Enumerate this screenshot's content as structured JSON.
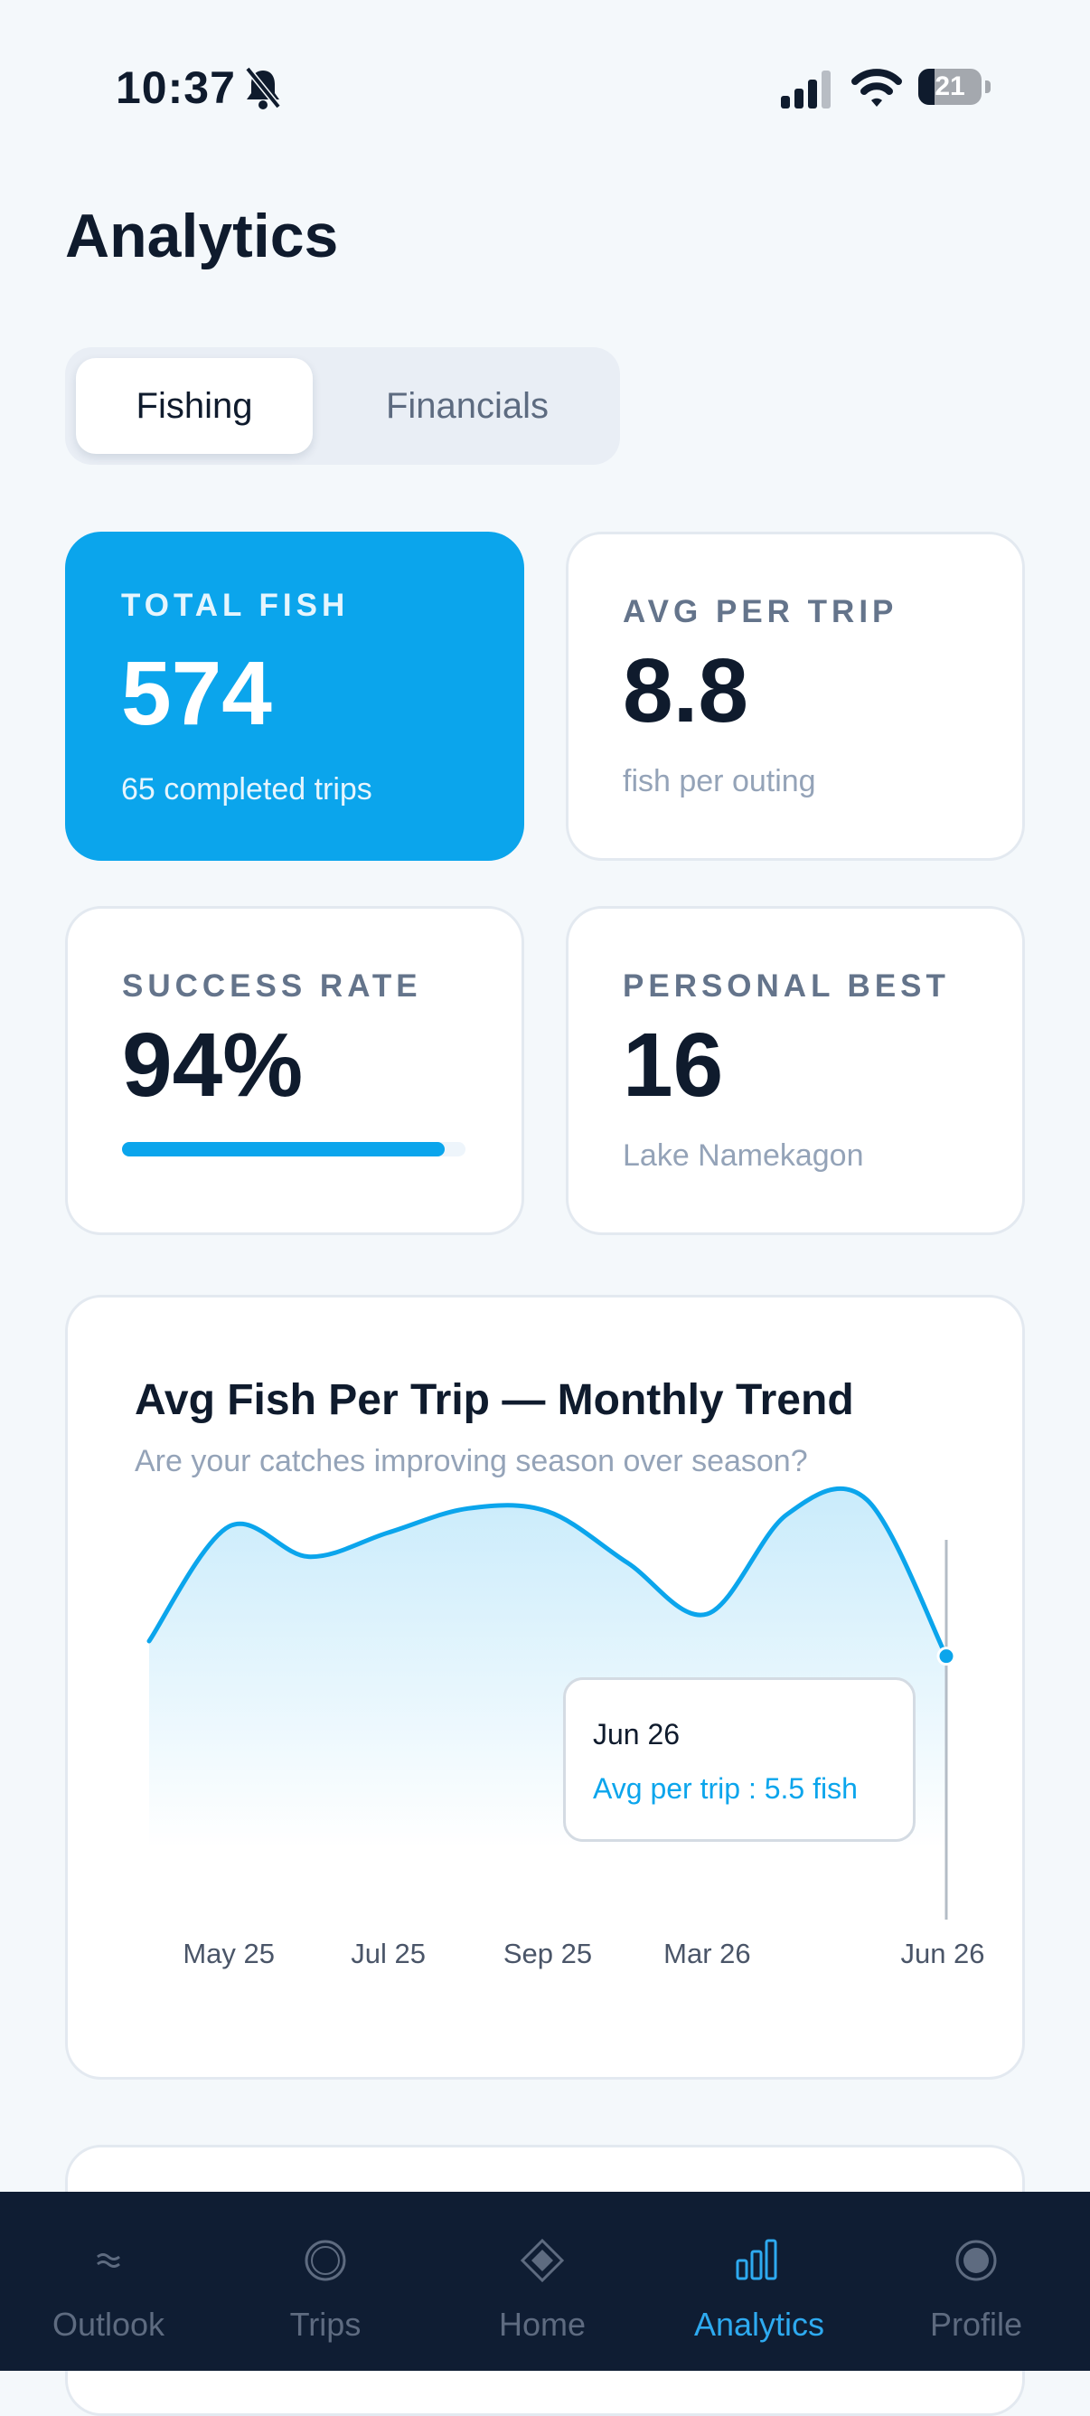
{
  "status_bar": {
    "time": "10:37",
    "battery": "21"
  },
  "header": {
    "title": "Analytics"
  },
  "segment": {
    "fishing": "Fishing",
    "financials": "Financials",
    "selected": "Fishing"
  },
  "stats": {
    "total_fish": {
      "label": "TOTAL FISH",
      "value": "574",
      "sub": "65 completed trips"
    },
    "avg_per_trip": {
      "label": "AVG PER TRIP",
      "value": "8.8",
      "sub": "fish per outing"
    },
    "success_rate": {
      "label": "SUCCESS RATE",
      "value": "94%",
      "progress": 0.94
    },
    "personal_best": {
      "label": "PERSONAL BEST",
      "value": "16",
      "sub": "Lake Namekagon"
    }
  },
  "chart_card": {
    "title": "Avg Fish Per Trip — Monthly Trend",
    "subtitle": "Are your catches improving season over season?",
    "tooltip": {
      "date": "Jun 26",
      "text": "Avg per trip : 5.5 fish"
    }
  },
  "chart_data": {
    "type": "area",
    "title": "Avg Fish Per Trip — Monthly Trend",
    "x": [
      "Apr 25",
      "May 25",
      "Jun 25",
      "Jul 25",
      "Aug 25",
      "Sep 25",
      "Oct 25",
      "Mar 26",
      "Apr 26",
      "May 26",
      "Jun 26"
    ],
    "tick_labels": [
      "May 25",
      "Jul 25",
      "Sep 25",
      "Mar 26",
      "Jun 26"
    ],
    "series": [
      {
        "values": [
          6.0,
          9.8,
          8.8,
          9.6,
          10.4,
          10.3,
          8.6,
          6.9,
          10.2,
          10.7,
          5.5
        ]
      }
    ],
    "ylim": [
      0,
      12
    ],
    "grid": false,
    "highlight": {
      "x": "Jun 26",
      "value": 5.5
    },
    "color": "#0ba5ec"
  },
  "tabbar": {
    "items": [
      {
        "label": "Outlook",
        "icon": "waves-icon"
      },
      {
        "label": "Trips",
        "icon": "circle-icon"
      },
      {
        "label": "Home",
        "icon": "diamond-icon"
      },
      {
        "label": "Analytics",
        "icon": "bar-chart-icon"
      },
      {
        "label": "Profile",
        "icon": "profile-icon"
      }
    ],
    "active": "Analytics"
  },
  "colors": {
    "accent": "#0ba5ec",
    "tabbar": "#0f1d33",
    "background": "#f4f8fb"
  }
}
